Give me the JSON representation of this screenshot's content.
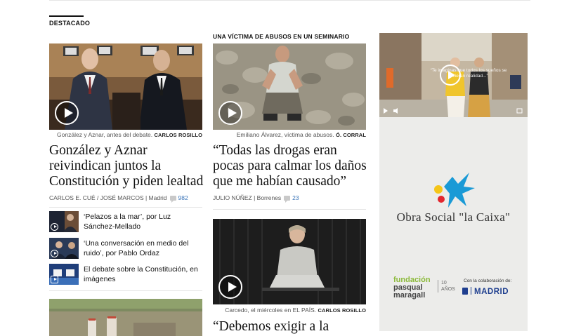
{
  "section": {
    "label": "DESTACADO"
  },
  "article_main": {
    "caption_text": "González y Aznar, antes del debate.",
    "caption_credit": "CARLOS ROSILLO",
    "headline": "González y Aznar reivindican juntos la Constitución y piden lealtad",
    "byline": "CARLOS E. CUÉ / JOSÉ MARCOS | Madrid",
    "comments": "982"
  },
  "related": [
    {
      "title": "‘Pelazos a la mar’, por Luz Sánchez-Mellado"
    },
    {
      "title": "‘Una conversación en medio del ruido’, por Pablo Ordaz"
    },
    {
      "title": "El debate sobre la Constitución, en imágenes"
    }
  ],
  "article_second": {
    "kicker": "UNA VÍCTIMA DE ABUSOS EN UN SEMINARIO",
    "caption_text": "Emiliano Álvarez, víctima de abusos.",
    "caption_credit": "Ó. CORRAL",
    "headline": "“Todas las drogas eran pocas para calmar los daños que me habían causado”",
    "byline": "JULIO NÚÑEZ | Borrenes",
    "comments": "23"
  },
  "article_third": {
    "caption_text": "Carcedo, el miércoles en EL PAÍS.",
    "caption_credit": "CARLOS ROSILLO",
    "headline": "“Debemos exigir a la"
  },
  "ad": {
    "video_subtitle": "“Te imaginas que todos los sueños se hicieran realidad...”",
    "org_name": "Obra Social \"la Caixa\"",
    "fund_line1": "fundación",
    "fund_line2": "pasqual",
    "fund_line3": "maragall",
    "ten_years_1": "10",
    "ten_years_2": "AÑOS",
    "collab": "Con la colaboración de:",
    "madrid": "MADRID"
  },
  "colors": {
    "accent_blue": "#3a74b8",
    "caixa_blue": "#1a9ad6",
    "caixa_yellow": "#f5c518",
    "caixa_red": "#e3262e",
    "fund_green": "#8bb93a",
    "madrid_blue": "#1f3f8f"
  }
}
